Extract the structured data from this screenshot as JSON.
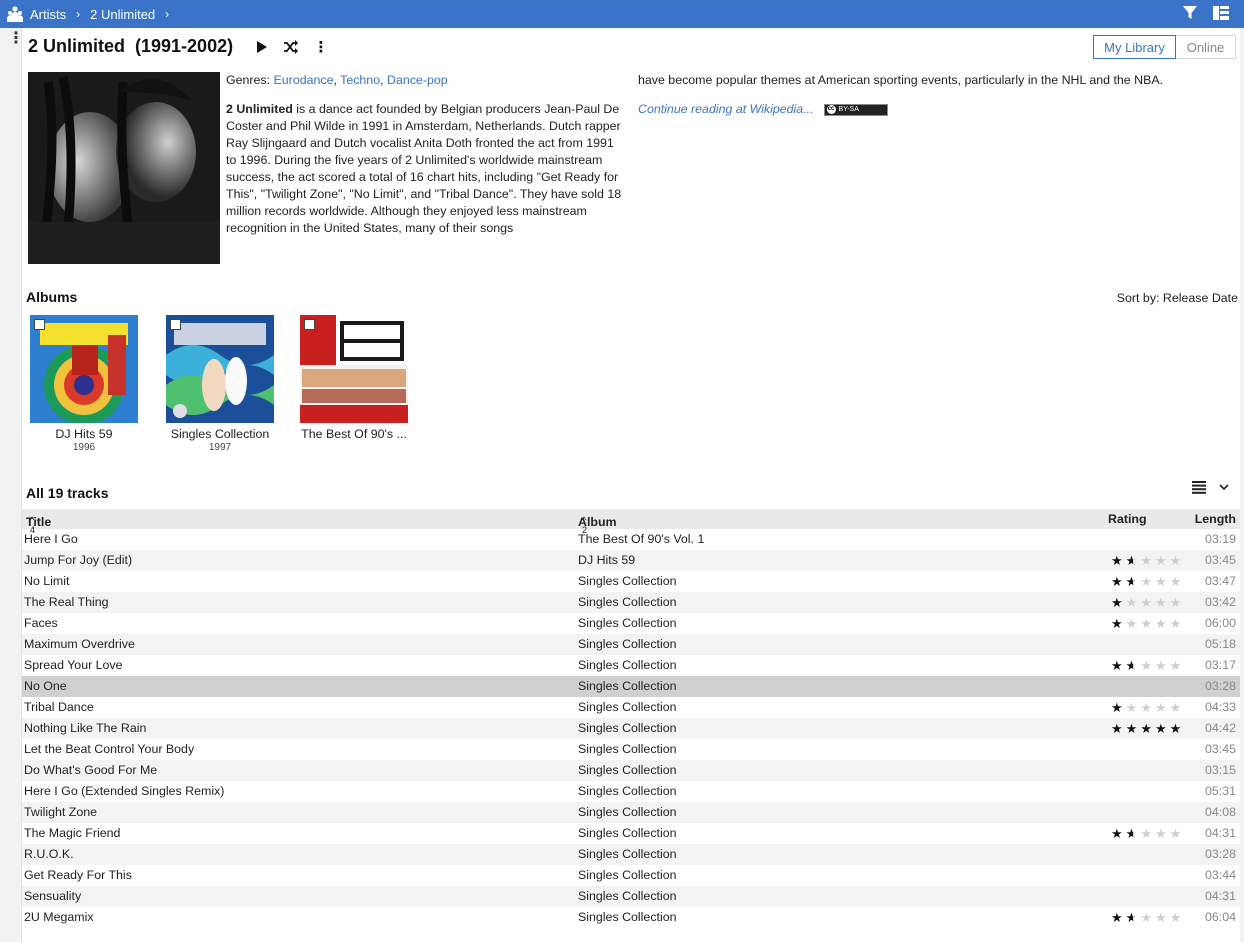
{
  "breadcrumb": {
    "items": [
      "Artists",
      "2 Unlimited"
    ]
  },
  "artist": {
    "name": "2 Unlimited",
    "years": "(1991-2002)",
    "genres_label": "Genres:",
    "genres": [
      "Eurodance",
      "Techno",
      "Dance-pop"
    ],
    "bio_name": "2 Unlimited",
    "bio_part1": " is a dance act founded by Belgian producers Jean-Paul De Coster and Phil Wilde in 1991 in Amsterdam, Netherlands. Dutch rapper Ray Slijngaard and Dutch vocalist Anita Doth fronted the act from 1991 to 1996. During the five years of 2 Unlimited's worldwide mainstream success, the act scored a total of 16 chart hits, including \"Get Ready for This\", \"Twilight Zone\", \"No Limit\", and \"Tribal Dance\". They have sold 18 million records worldwide. Although they enjoyed less mainstream recognition in the United States, many of their songs",
    "bio_part2": "have become popular themes at American sporting events, particularly in the NHL and the NBA.",
    "continue_label": "Continue reading at Wikipedia...",
    "license_badge": "BY-SA"
  },
  "source_toggle": {
    "my_library": "My Library",
    "online": "Online",
    "active": "My Library"
  },
  "albums_section": {
    "title": "Albums",
    "sort_label": "Sort by:",
    "sort_value": "Release Date",
    "albums": [
      {
        "name": "DJ Hits 59",
        "year": "1996"
      },
      {
        "name": "Singles Collection",
        "year": "1997"
      },
      {
        "name": "The Best Of 90's ...",
        "year": ""
      }
    ]
  },
  "tracks_section": {
    "title": "All 19 tracks",
    "columns": {
      "title": "Title",
      "title_sort": "^ 4",
      "album": "Album",
      "album_sort": "^ 2",
      "rating": "Rating",
      "length": "Length"
    },
    "tracks": [
      {
        "title": "Here I Go",
        "album": "The Best Of 90's Vol. 1",
        "rating": null,
        "length": "03:19"
      },
      {
        "title": "Jump For Joy (Edit)",
        "album": "DJ Hits 59",
        "rating": 1.5,
        "length": "03:45"
      },
      {
        "title": "No Limit",
        "album": "Singles Collection",
        "rating": 1.5,
        "length": "03:47"
      },
      {
        "title": "The Real Thing",
        "album": "Singles Collection",
        "rating": 1,
        "length": "03:42"
      },
      {
        "title": "Faces",
        "album": "Singles Collection",
        "rating": 1,
        "length": "06:00"
      },
      {
        "title": "Maximum Overdrive",
        "album": "Singles Collection",
        "rating": null,
        "length": "05:18"
      },
      {
        "title": "Spread Your Love",
        "album": "Singles Collection",
        "rating": 1.5,
        "length": "03:17"
      },
      {
        "title": "No One",
        "album": "Singles Collection",
        "rating": null,
        "length": "03:28",
        "selected": true
      },
      {
        "title": "Tribal Dance",
        "album": "Singles Collection",
        "rating": 1,
        "length": "04:33"
      },
      {
        "title": "Nothing Like The Rain",
        "album": "Singles Collection",
        "rating": 5,
        "length": "04:42"
      },
      {
        "title": "Let the Beat Control Your Body",
        "album": "Singles Collection",
        "rating": null,
        "length": "03:45"
      },
      {
        "title": "Do What's Good For Me",
        "album": "Singles Collection",
        "rating": null,
        "length": "03:15"
      },
      {
        "title": "Here I Go (Extended Singles Remix)",
        "album": "Singles Collection",
        "rating": null,
        "length": "05:31"
      },
      {
        "title": "Twilight Zone",
        "album": "Singles Collection",
        "rating": null,
        "length": "04:08"
      },
      {
        "title": "The Magic Friend",
        "album": "Singles Collection",
        "rating": 1.5,
        "length": "04:31"
      },
      {
        "title": "R.U.O.K.",
        "album": "Singles Collection",
        "rating": null,
        "length": "03:28"
      },
      {
        "title": "Get Ready For This",
        "album": "Singles Collection",
        "rating": null,
        "length": "03:44"
      },
      {
        "title": "Sensuality",
        "album": "Singles Collection",
        "rating": null,
        "length": "04:31"
      },
      {
        "title": "2U Megamix",
        "album": "Singles Collection",
        "rating": 1.5,
        "length": "06:04"
      }
    ]
  },
  "colors": {
    "accent": "#3a73c8",
    "header_bg": "#e9e9e9",
    "row_alt": "#f3f3f3",
    "row_selected": "#d0d0d0"
  },
  "icons": [
    "home-people-icon",
    "chevron-right-icon",
    "filter-icon",
    "layout-icon",
    "more-vertical-icon",
    "play-icon",
    "shuffle-icon",
    "list-view-icon",
    "chevron-down-icon",
    "floppy-disk-icon",
    "star-icon"
  ]
}
